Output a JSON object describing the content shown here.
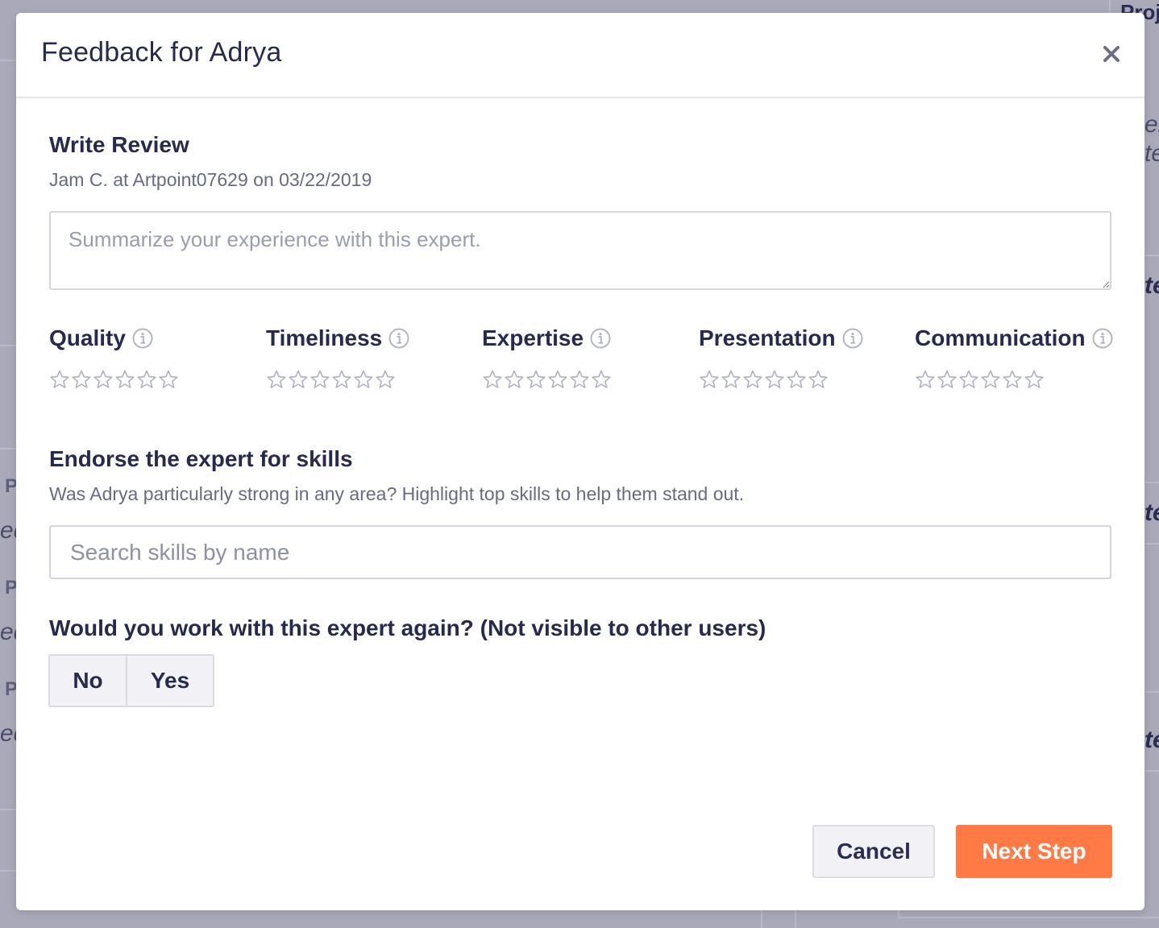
{
  "background": {
    "fragments": [
      "Proj",
      "er",
      "te",
      "te",
      "te",
      "te",
      "P",
      "ed",
      "P",
      "ed",
      "P",
      "ed"
    ]
  },
  "modal": {
    "title": "Feedback for Adrya",
    "close_icon": "close-icon"
  },
  "review": {
    "heading": "Write Review",
    "meta": "Jam C. at Artpoint07629 on 03/22/2019",
    "placeholder": "Summarize your experience with this expert.",
    "value": ""
  },
  "ratings": [
    {
      "label": "Quality",
      "stars_max": 6,
      "value": 0,
      "icon": "info-icon"
    },
    {
      "label": "Timeliness",
      "stars_max": 6,
      "value": 0,
      "icon": "info-icon"
    },
    {
      "label": "Expertise",
      "stars_max": 6,
      "value": 0,
      "icon": "info-icon"
    },
    {
      "label": "Presentation",
      "stars_max": 6,
      "value": 0,
      "icon": "info-icon"
    },
    {
      "label": "Communication",
      "stars_max": 6,
      "value": 0,
      "icon": "info-icon"
    }
  ],
  "skills": {
    "heading": "Endorse the expert for skills",
    "description": "Was Adrya particularly strong in any area? Highlight top skills to help them stand out.",
    "placeholder": "Search skills by name"
  },
  "work_again": {
    "question": "Would you work with this expert again? (Not visible to other users)",
    "no_label": "No",
    "yes_label": "Yes"
  },
  "footer": {
    "cancel_label": "Cancel",
    "next_label": "Next Step"
  },
  "colors": {
    "accent": "#ff7a45",
    "text_primary": "#262a4f",
    "text_muted": "#676a84",
    "overlay": "#a9a9b9"
  }
}
